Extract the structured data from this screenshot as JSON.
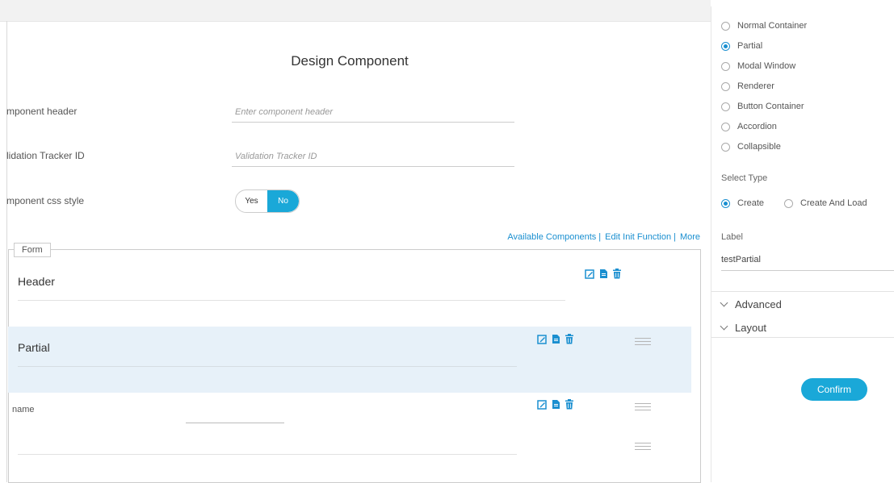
{
  "page_title": "Design Component",
  "fields": [
    {
      "label": "mponent header",
      "placeholder": "Enter component header"
    },
    {
      "label": "lidation Tracker ID",
      "placeholder": "Validation Tracker ID"
    },
    {
      "label": "mponent css style"
    }
  ],
  "toggle": {
    "yes": "Yes",
    "no": "No",
    "selected": "No"
  },
  "links": {
    "available": "Available Components",
    "edit_init": "Edit Init Function",
    "more": "More",
    "separator": "|"
  },
  "form": {
    "legend": "Form",
    "rows": [
      {
        "title": "Header"
      },
      {
        "title": "Partial",
        "selected": true
      },
      {
        "title": "name"
      }
    ]
  },
  "right_panel": {
    "container_types": [
      {
        "label": "Normal Container",
        "selected": false
      },
      {
        "label": "Partial",
        "selected": true
      },
      {
        "label": "Modal Window",
        "selected": false
      },
      {
        "label": "Renderer",
        "selected": false
      },
      {
        "label": "Button Container",
        "selected": false
      },
      {
        "label": "Accordion",
        "selected": false
      },
      {
        "label": "Collapsible",
        "selected": false
      }
    ],
    "select_type_label": "Select Type",
    "select_types": [
      {
        "label": "Create",
        "selected": true
      },
      {
        "label": "Create And Load",
        "selected": false
      }
    ],
    "label_caption": "Label",
    "label_value": "testPartial",
    "sections": [
      "Advanced",
      "Layout"
    ],
    "confirm": "Confirm"
  },
  "colors": {
    "accent": "#1aa8d8",
    "link": "#1a8fd0",
    "selected_row": "#e7f1f9"
  }
}
